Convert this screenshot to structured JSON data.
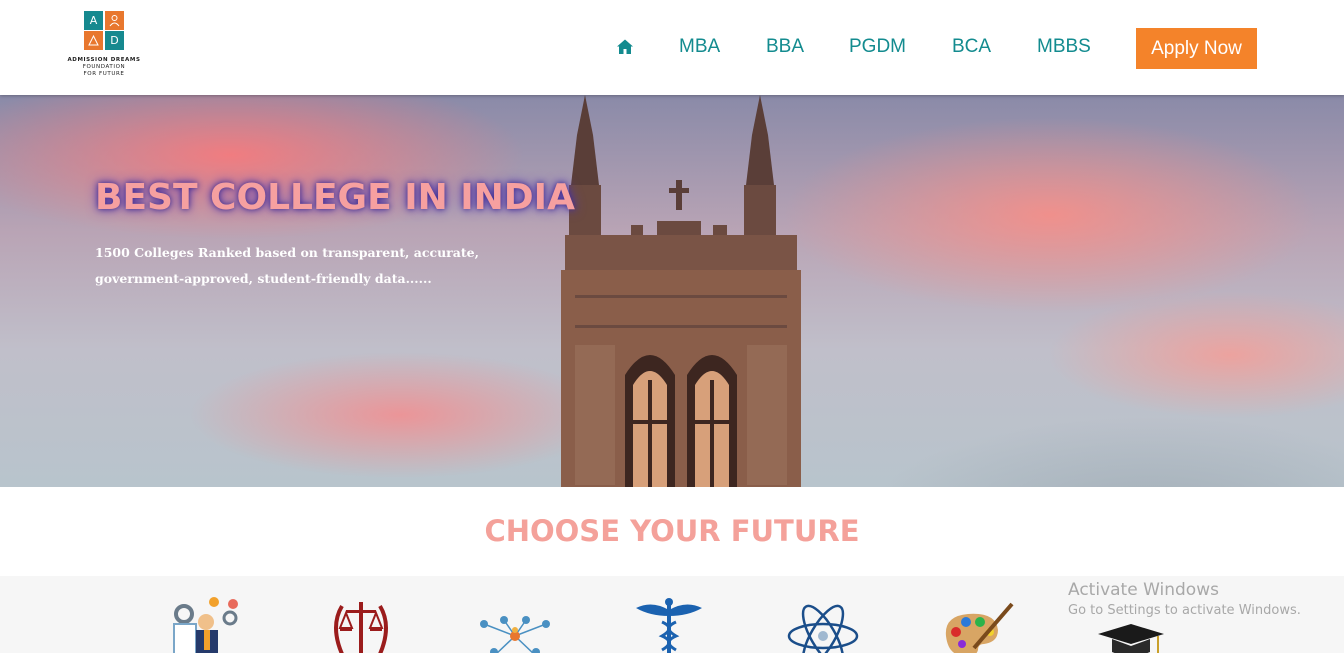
{
  "logo": {
    "letters": [
      "A",
      "",
      "",
      "D"
    ],
    "line1": "ADMISSION DREAMS",
    "line2": "FOUNDATION",
    "line3": "FOR FUTURE"
  },
  "nav": {
    "home_icon": "home-icon",
    "links": [
      "MBA",
      "BBA",
      "PGDM",
      "BCA",
      "MBBS"
    ],
    "apply_label": "Apply Now"
  },
  "hero": {
    "title": "BEST COLLEGE IN INDIA",
    "subtitle": "1500 Colleges Ranked based on transparent, accurate, government-approved, student-friendly data......"
  },
  "choose": {
    "title": "CHOOSE YOUR FUTURE",
    "icons": [
      "management-icon",
      "law-scales-icon",
      "network-people-icon",
      "medical-caduceus-icon",
      "science-atom-icon",
      "art-palette-icon",
      "graduation-cap-icon"
    ]
  },
  "watermark": {
    "title": "Activate Windows",
    "subtitle": "Go to Settings to activate Windows."
  },
  "colors": {
    "teal": "#138b8f",
    "orange": "#f4832a",
    "title_pink": "#f4a19a"
  }
}
